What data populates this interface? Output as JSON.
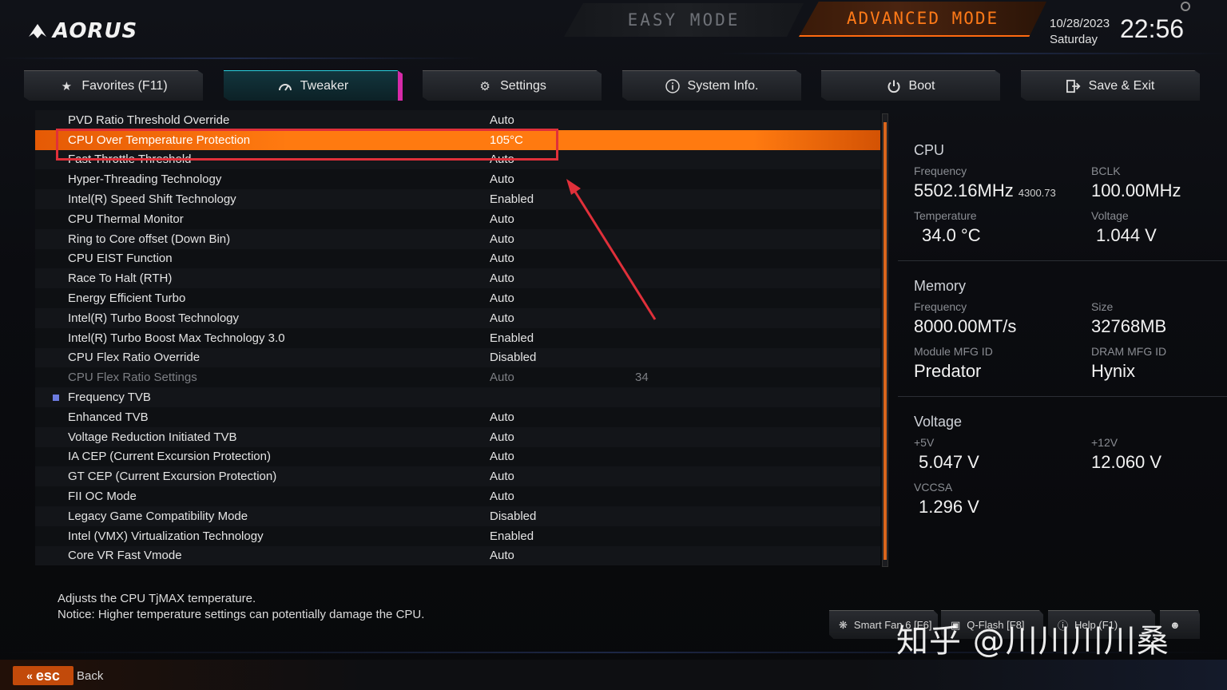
{
  "header": {
    "logo_text": "AORUS",
    "easy_mode": "EASY MODE",
    "advanced_mode": "ADVANCED MODE",
    "date": "10/28/2023",
    "day": "Saturday",
    "time": "22:56"
  },
  "tabs": [
    {
      "label": "Favorites (F11)",
      "icon": "star-folder-icon"
    },
    {
      "label": "Tweaker",
      "icon": "gauge-icon",
      "active": true
    },
    {
      "label": "Settings",
      "icon": "gear-icon"
    },
    {
      "label": "System Info.",
      "icon": "info-icon"
    },
    {
      "label": "Boot",
      "icon": "power-icon"
    },
    {
      "label": "Save & Exit",
      "icon": "exit-icon"
    }
  ],
  "settings": [
    {
      "name": "PVD Ratio Threshold Override",
      "value": "Auto"
    },
    {
      "name": "CPU Over Temperature Protection",
      "value": "105°C",
      "selected": true
    },
    {
      "name": "Fast Throttle Threshold",
      "value": "Auto"
    },
    {
      "name": "Hyper-Threading Technology",
      "value": "Auto"
    },
    {
      "name": "Intel(R) Speed Shift Technology",
      "value": "Enabled"
    },
    {
      "name": "CPU Thermal Monitor",
      "value": "Auto"
    },
    {
      "name": "Ring to Core offset (Down Bin)",
      "value": "Auto"
    },
    {
      "name": "CPU EIST Function",
      "value": "Auto"
    },
    {
      "name": "Race To Halt (RTH)",
      "value": "Auto"
    },
    {
      "name": "Energy Efficient Turbo",
      "value": "Auto"
    },
    {
      "name": "Intel(R) Turbo Boost Technology",
      "value": "Auto"
    },
    {
      "name": "Intel(R) Turbo Boost Max Technology 3.0",
      "value": "Enabled"
    },
    {
      "name": "CPU Flex Ratio Override",
      "value": "Disabled"
    },
    {
      "name": "CPU Flex Ratio Settings",
      "value": "Auto",
      "extra": "34",
      "dim": true
    },
    {
      "name": "Frequency TVB",
      "value": "",
      "bullet": true
    },
    {
      "name": "Enhanced TVB",
      "value": "Auto"
    },
    {
      "name": "Voltage Reduction Initiated TVB",
      "value": "Auto"
    },
    {
      "name": "IA CEP (Current Excursion Protection)",
      "value": "Auto"
    },
    {
      "name": "GT CEP (Current Excursion Protection)",
      "value": "Auto"
    },
    {
      "name": "FII OC Mode",
      "value": "Auto"
    },
    {
      "name": "Legacy Game Compatibility Mode",
      "value": "Disabled"
    },
    {
      "name": "Intel (VMX) Virtualization Technology",
      "value": "Enabled"
    },
    {
      "name": "Core VR Fast Vmode",
      "value": "Auto"
    }
  ],
  "panel": {
    "cpu": {
      "title": "CPU",
      "frequency_label": "Frequency",
      "frequency": "5502.16MHz",
      "frequency_sub": "4300.73",
      "bclk_label": "BCLK",
      "bclk": "100.00MHz",
      "temp_label": "Temperature",
      "temp": "34.0 °C",
      "voltage_label": "Voltage",
      "voltage": "1.044 V"
    },
    "memory": {
      "title": "Memory",
      "frequency_label": "Frequency",
      "frequency": "8000.00MT/s",
      "size_label": "Size",
      "size": "32768MB",
      "module_label": "Module MFG ID",
      "module": "Predator",
      "dram_label": "DRAM MFG ID",
      "dram": "Hynix"
    },
    "voltage": {
      "title": "Voltage",
      "v5_label": "+5V",
      "v5": "5.047 V",
      "v12_label": "+12V",
      "v12": "12.060 V",
      "vccsa_label": "VCCSA",
      "vccsa": "1.296 V"
    }
  },
  "help": {
    "line1": "Adjusts the CPU TjMAX temperature.",
    "line2": "Notice: Higher temperature settings can potentially damage the CPU."
  },
  "footer": {
    "smart_fan": "Smart Fan 6 [F6]",
    "qflash": "Q-Flash [F8]",
    "help": "Help (F1)",
    "esc": "esc",
    "back": "Back",
    "watermark": "知乎 @川川川川桑"
  },
  "colors": {
    "accent": "#ff7a10",
    "selected_row": "#ff7a10",
    "active_tab": "#2ad2e0",
    "highlight_box": "#e0303a"
  }
}
